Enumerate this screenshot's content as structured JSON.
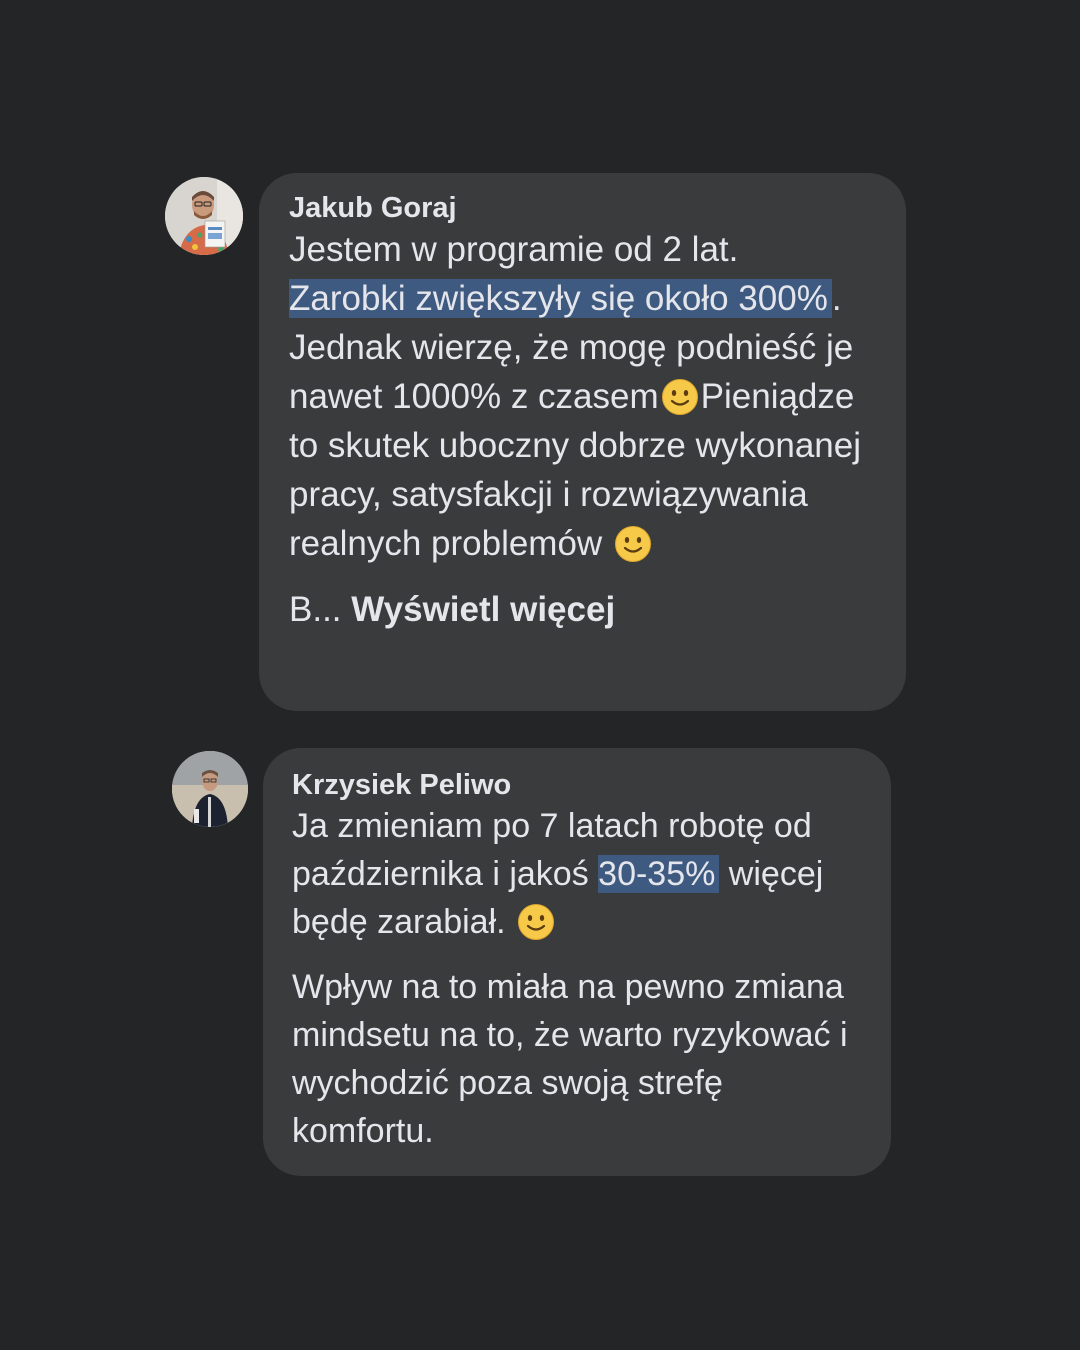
{
  "comments": [
    {
      "author": "Jakub Goraj",
      "text_line1": "Jestem w programie od 2 lat.",
      "text_highlight": "Zarobki zwiększyły się około 300%",
      "text_after_highlight": ". Jednak wierzę, że mogę podnieść je nawet 1000% z czasem",
      "text_after_emoji1": "Pieniądze to skutek uboczny dobrze wykonanej pracy, satysfakcji i rozwiązywania realnych problemów ",
      "emoji": "slightly-smiling-face-emoji",
      "truncated_prefix": "B... ",
      "see_more_label": "Wyświetl więcej"
    },
    {
      "author": "Krzysiek Peliwo",
      "text_before_highlight": "Ja zmieniam po 7 latach robotę od października i jakoś ",
      "text_highlight": "30-35%",
      "text_after_highlight": " więcej będę zarabiał. ",
      "emoji": "slightly-smiling-face-emoji",
      "paragraph2": "Wpływ na to miała na pewno zmiana mindsetu na to, że warto ryzykować i wychodzić poza swoją strefę komfortu."
    }
  ],
  "colors": {
    "background": "#242526",
    "bubble": "#3a3b3c",
    "text": "#e4e6eb",
    "highlight": "#3e5a80"
  }
}
